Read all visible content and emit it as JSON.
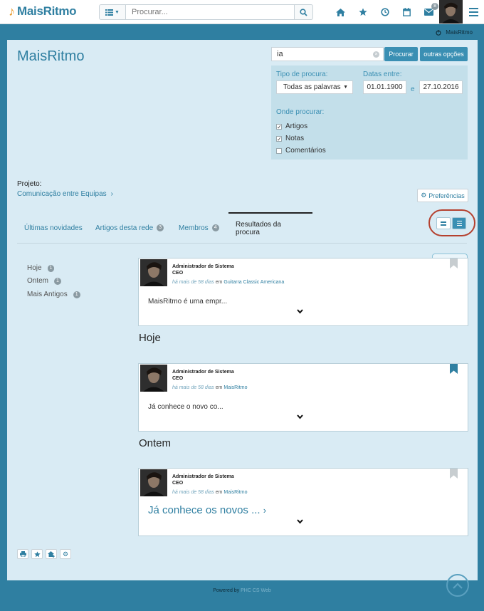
{
  "app": {
    "brand": "MaisRitmo"
  },
  "topbar": {
    "search_placeholder": "Procurar...",
    "notification_count": "8"
  },
  "system_user": "MaisRitmo",
  "page": {
    "title": "MaisRitmo"
  },
  "search": {
    "query": "ia",
    "search_label": "Procurar",
    "options_label": "outras opções",
    "type_label": "Tipo de procura:",
    "type_value": "Todas as palavras",
    "dates_label": "Datas entre:",
    "date_from": "01.01.1900",
    "date_sep": "e",
    "date_to": "27.10.2016",
    "where_label": "Onde procurar:",
    "where": [
      {
        "label": "Artigos",
        "checked": true
      },
      {
        "label": "Notas",
        "checked": true
      },
      {
        "label": "Comentários",
        "checked": false
      }
    ]
  },
  "project": {
    "label": "Projeto:",
    "name": "Comunicação entre Equipas"
  },
  "preferences_label": "Preferências",
  "tabs": [
    {
      "label": "Últimas novidades",
      "count": ""
    },
    {
      "label": "Artigos desta rede",
      "count": "3"
    },
    {
      "label": "Membros",
      "count": "4"
    },
    {
      "label": "Resultados da procura",
      "count": ""
    }
  ],
  "date_filters": [
    {
      "label": "Hoje",
      "count": "1"
    },
    {
      "label": "Ontem",
      "count": "1"
    },
    {
      "label": "Mais Antigos",
      "count": "1"
    }
  ],
  "sections": {
    "today": "Hoje",
    "yesterday": "Ontem"
  },
  "posts": [
    {
      "author": "Administrador de Sistema",
      "role": "CEO",
      "when": "há mais de 58 dias",
      "in": "em",
      "place": "Guitarra Classic Americana",
      "excerpt": "MaisRitmo é uma empr...",
      "bookmarked": false
    },
    {
      "author": "Administrador de Sistema",
      "role": "CEO",
      "when": "há mais de 58 dias",
      "in": "em",
      "place": "MaisRitmo",
      "excerpt": "Já conhece o novo co...",
      "bookmarked": true
    },
    {
      "author": "Administrador de Sistema",
      "role": "CEO",
      "when": "há mais de 58 dias",
      "in": "em",
      "place": "MaisRitmo",
      "excerpt": "Já conhece os novos ...",
      "bookmarked": false
    }
  ],
  "footer": {
    "powered": "Powered by",
    "product": "PHC CS Web"
  },
  "colors": {
    "accent": "#2f7fa1",
    "panel": "#d9ebf4",
    "highlight_ring": "#b5412f"
  }
}
